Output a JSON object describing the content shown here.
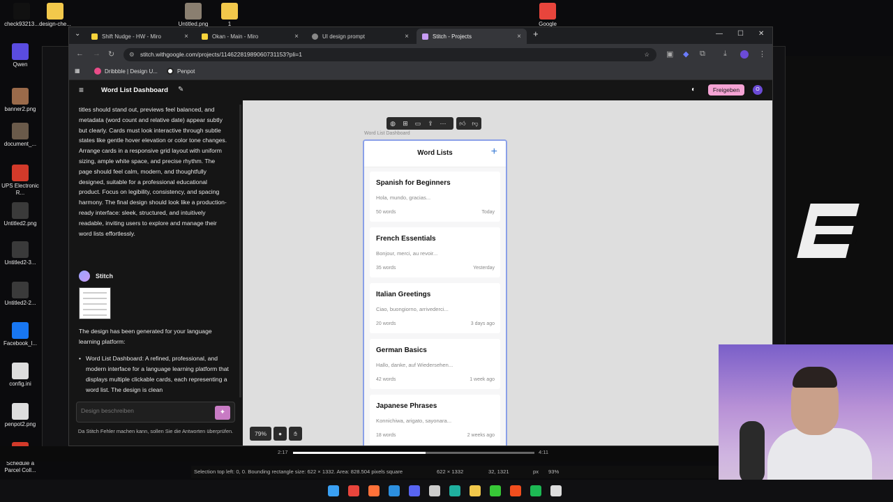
{
  "desktop": {
    "icons": [
      {
        "label": "check93213...",
        "color": "#111111"
      },
      {
        "label": "design-che...",
        "color": "#f2c84b"
      },
      {
        "label": "Untitled.png",
        "color": "#8a7f70"
      },
      {
        "label": "1",
        "color": "#f2c84b"
      },
      {
        "label": "Google",
        "color": "#e8453c"
      },
      {
        "label": "Qwen",
        "color": "#5a4ce0"
      },
      {
        "label": "banner2.png",
        "color": "#9a6a4a"
      },
      {
        "label": "document_...",
        "color": "#6a5a4a"
      },
      {
        "label": "UPS Electronic R...",
        "color": "#d23a2a"
      },
      {
        "label": "Untitled2.png",
        "color": "#3a3a3a"
      },
      {
        "label": "Untitled2-3...",
        "color": "#3a3a3a"
      },
      {
        "label": "Untitled2-2...",
        "color": "#3a3a3a"
      },
      {
        "label": "Facebook_l...",
        "color": "#1877f2"
      },
      {
        "label": "config.ini",
        "color": "#dddddd"
      },
      {
        "label": "penpot2.png",
        "color": "#dddddd"
      },
      {
        "label": "Schedule a Parcel Coll...",
        "color": "#d23a2a"
      }
    ]
  },
  "browser": {
    "tabs": [
      {
        "label": "Shift Nudge - HW - Miro",
        "color": "#f7d33b",
        "active": false
      },
      {
        "label": "Okan - Main - Miro",
        "color": "#f7d33b",
        "active": false
      },
      {
        "label": "UI design prompt",
        "color": "#cccccc",
        "active": false
      },
      {
        "label": "Stitch - Projects",
        "color": "#c79cf4",
        "active": true
      }
    ],
    "url": "stitch.withgoogle.com/projects/11462281989060731153?pli=1",
    "bookmarks": [
      {
        "label": "Dribbble | Design U...",
        "color": "#ea4c89"
      },
      {
        "label": "Penpot",
        "color": "#222222"
      }
    ]
  },
  "app": {
    "title": "Word List Dashboard",
    "share_label": "Freigeben",
    "avatar_letter": "O",
    "chat": {
      "prompt_text": "titles should stand out, previews feel balanced, and metadata (word count and relative date) appear subtly but clearly. Cards must look interactive through subtle states like gentle hover elevation or color tone changes. Arrange cards in a responsive grid layout with uniform sizing, ample white space, and precise rhythm. The page should feel calm, modern, and thoughtfully designed, suitable for a professional educational product. Focus on legibility, consistency, and spacing harmony. The final design should look like a production-ready interface: sleek, structured, and intuitively readable, inviting users to explore and manage their word lists effortlessly.",
      "assistant_name": "Stitch",
      "generated_text": "The design has been generated for your language learning platform:",
      "bullet_text": "Word List Dashboard: A refined, professional, and modern interface for a language learning platform that displays multiple clickable cards, each representing a word list. The design is clean",
      "input_placeholder": "Design beschreiben",
      "disclaimer": "Da Stitch Fehler machen kann, sollen Sie die Antworten überprüfen."
    },
    "canvas": {
      "frame_label": "Word List Dashboard",
      "zoom": "79%",
      "screen": {
        "title": "Word Lists",
        "cards": [
          {
            "title": "Spanish for Beginners",
            "preview": "Hola, mundo, gracias...",
            "count": "50 words",
            "date": "Today"
          },
          {
            "title": "French Essentials",
            "preview": "Bonjour, merci, au revoir...",
            "count": "35 words",
            "date": "Yesterday"
          },
          {
            "title": "Italian Greetings",
            "preview": "Ciao, buongiorno, arrivederci...",
            "count": "20 words",
            "date": "3 days ago"
          },
          {
            "title": "German Basics",
            "preview": "Hallo, danke, auf Wiedersehen...",
            "count": "42 words",
            "date": "1 week ago"
          },
          {
            "title": "Japanese Phrases",
            "preview": "Konnichiwa, arigato, sayonara...",
            "count": "18 words",
            "date": "2 weeks ago"
          }
        ]
      }
    }
  },
  "video": {
    "time_current": "2:17",
    "time_total": "4:11",
    "progress": 0.55
  },
  "status": {
    "selection": "Selection top left: 0, 0. Bounding rectangle size: 622 × 1332. Area: 828.504 pixels square",
    "size": "622 × 1332",
    "cursor": "32, 1321",
    "unit": "px",
    "zoom": "93%"
  },
  "taskbar": {
    "icons": [
      {
        "name": "start",
        "color": "#3aa0f3"
      },
      {
        "name": "chrome",
        "color": "#e8453c"
      },
      {
        "name": "firefox",
        "color": "#ff7139"
      },
      {
        "name": "vscode",
        "color": "#2c8fe0"
      },
      {
        "name": "discord",
        "color": "#5865f2"
      },
      {
        "name": "obs",
        "color": "#cccccc"
      },
      {
        "name": "edge",
        "color": "#1fb0a0"
      },
      {
        "name": "files",
        "color": "#f2c84b"
      },
      {
        "name": "winamp",
        "color": "#37c837"
      },
      {
        "name": "figma",
        "color": "#f24e1e"
      },
      {
        "name": "spotify",
        "color": "#1db954"
      },
      {
        "name": "paint",
        "color": "#dddddd"
      }
    ]
  }
}
